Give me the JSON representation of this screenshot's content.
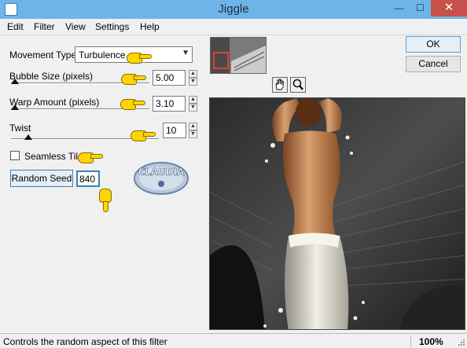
{
  "window": {
    "title": "Jiggle",
    "minimize_glyph": "—",
    "maximize_glyph": "☐",
    "close_glyph": "✕"
  },
  "menu": [
    "Edit",
    "Filter",
    "View",
    "Settings",
    "Help"
  ],
  "controls": {
    "movement_type_label": "Movement Type:",
    "movement_type_value": "Turbulence",
    "bubble_size_label": "Bubble Size (pixels)",
    "bubble_size_value": "5.00",
    "warp_amount_label": "Warp Amount (pixels)",
    "warp_amount_value": "3.10",
    "twist_label": "Twist",
    "twist_value": "10",
    "seamless_tile_label": "Seamless Tile",
    "seamless_tile_checked": false,
    "random_seed_label": "Random Seed",
    "random_seed_value": "840"
  },
  "buttons": {
    "ok": "OK",
    "cancel": "Cancel"
  },
  "watermark": {
    "text": "CLAUDIA"
  },
  "status": {
    "hint": "Controls the random aspect of this filter",
    "zoom": "100%"
  },
  "icons": {
    "pan": "hand-pan-icon",
    "zoom": "magnifier-icon",
    "pointer": "pointing-hand-icon"
  }
}
